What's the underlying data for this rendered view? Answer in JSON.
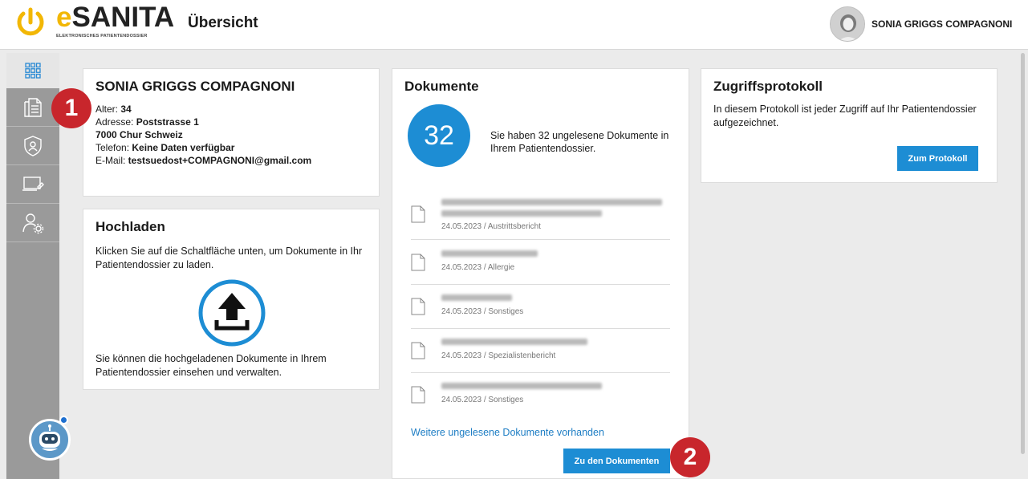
{
  "header": {
    "logo_e": "e",
    "logo_rest": "SANITA",
    "logo_subtitle": "ELEKTRONISCHES PATIENTENDOSSIER",
    "page_title": "Übersicht",
    "user_name": "SONIA GRIGGS COMPAGNONI"
  },
  "sidebar": {
    "items": [
      {
        "icon": "grid-icon",
        "active": true
      },
      {
        "icon": "documents-icon"
      },
      {
        "icon": "shield-user-icon"
      },
      {
        "icon": "laptop-edit-icon"
      },
      {
        "icon": "user-settings-icon"
      }
    ]
  },
  "patient": {
    "name": "SONIA GRIGGS COMPAGNONI",
    "age_label": "Alter: ",
    "age_value": "34",
    "address_label": "Adresse: ",
    "address_line1": "Poststrasse 1",
    "address_line2": "7000 Chur Schweiz",
    "phone_label": "Telefon: ",
    "phone_value": "Keine Daten verfügbar",
    "email_label": "E-Mail: ",
    "email_value": "testsuedost+COMPAGNONI@gmail.com"
  },
  "upload": {
    "title": "Hochladen",
    "text_top": "Klicken Sie auf die Schaltfläche unten, um Dokumente in Ihr Patientendossier zu laden.",
    "text_bottom": "Sie können die hochgeladenen Dokumente in Ihrem Patientendossier einsehen und verwalten."
  },
  "documents": {
    "title": "Dokumente",
    "count": "32",
    "count_text": "Sie haben 32 ungelesene Dokumente in Ihrem Patientendossier.",
    "items": [
      {
        "meta": "24.05.2023 / Austrittsbericht"
      },
      {
        "meta": "24.05.2023 / Allergie"
      },
      {
        "meta": "24.05.2023 / Sonstiges"
      },
      {
        "meta": "24.05.2023 / Spezialistenbericht"
      },
      {
        "meta": "24.05.2023 / Sonstiges"
      }
    ],
    "more_link": "Weitere ungelesene Dokumente vorhanden",
    "button": "Zu den Dokumenten"
  },
  "protocol": {
    "title": "Zugriffsprotokoll",
    "text": "In diesem Protokoll ist jeder Zugriff auf Ihr Patientendossier aufgezeichnet.",
    "button": "Zum Protokoll"
  },
  "annotations": {
    "badge1": "1",
    "badge2": "2"
  },
  "colors": {
    "accent": "#1d8dd4",
    "logo_yellow": "#f2b705",
    "badge_red": "#c8262c",
    "sidebar_gray": "#9a9a9a"
  }
}
